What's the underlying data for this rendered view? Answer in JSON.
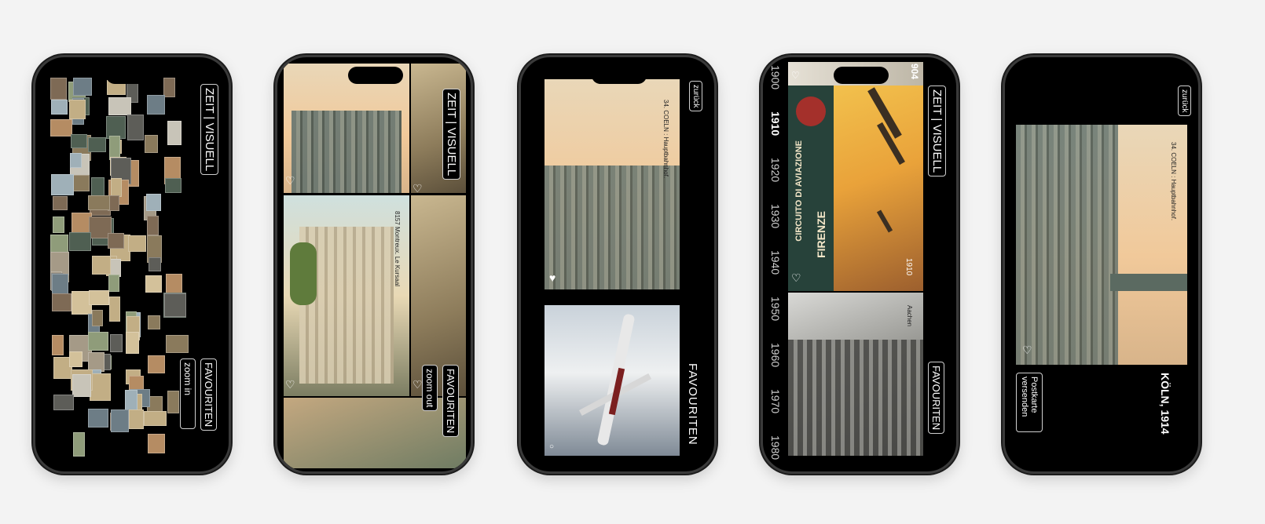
{
  "screens": {
    "overview": {
      "title": "ZEIT | VISUELL",
      "favourites": "FAVOURITEN",
      "zoom": "zoom in"
    },
    "zoomed": {
      "title": "ZEIT | VISUELL",
      "favourites": "FAVOURITEN",
      "zoom": "zoom out",
      "caption": "8157 Montreux. Le Kursaal"
    },
    "favourites": {
      "back": "zurück",
      "heading": "FAVOURITEN",
      "caption": "34. COELN : Hauptbahnhof."
    },
    "timeline": {
      "title": "ZEIT | VISUELL",
      "favourites": "FAVOURITEN",
      "years": [
        "1900",
        "1910",
        "1920",
        "1930",
        "1940",
        "1950",
        "1960",
        "1970",
        "1980"
      ],
      "active_year": "1910",
      "corner_year": "904",
      "card_year": "1910",
      "poster_text": "CIRCUITO DI AVIAZIONE",
      "poster_city": "FIRENZE",
      "caption_lower": "Aachen"
    },
    "detail": {
      "back": "zurück",
      "caption": "34. COELN : Hauptbahnhof.",
      "place": "KÖLN, 1914",
      "send": "Postkarte versenden"
    }
  },
  "colors": {
    "accent": "#ffffff",
    "background": "#f3f3f3",
    "screen": "#000000"
  },
  "icons": [
    "heart-icon"
  ]
}
